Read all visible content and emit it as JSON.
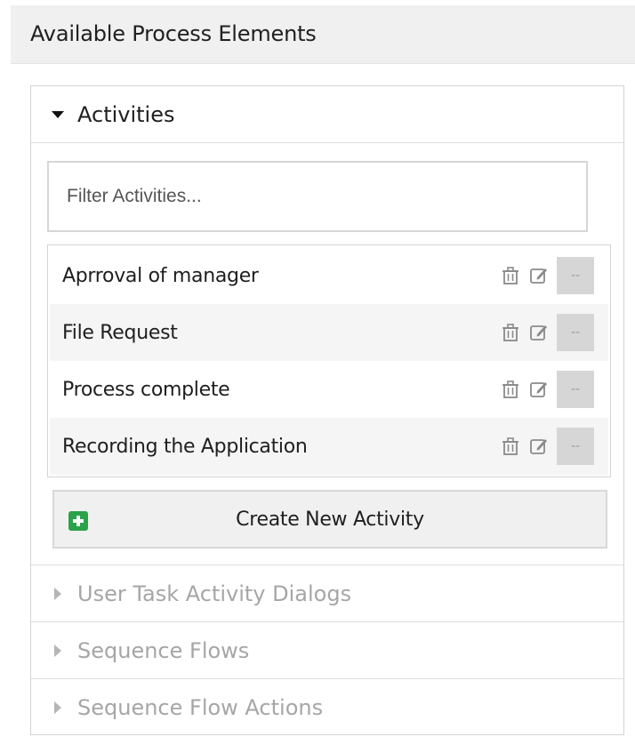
{
  "panel": {
    "title": "Available Process Elements"
  },
  "activities": {
    "header": "Activities",
    "filter_placeholder": "Filter Activities...",
    "items": [
      {
        "name": "Aprroval of manager",
        "actions": [
          "trash-icon",
          "edit-icon",
          "--"
        ]
      },
      {
        "name": "File Request",
        "actions": [
          "trash-icon",
          "edit-icon",
          "--"
        ]
      },
      {
        "name": "Process complete",
        "actions": [
          "trash-icon",
          "edit-icon",
          "--"
        ]
      },
      {
        "name": "Recording the Application",
        "actions": [
          "trash-icon",
          "edit-icon",
          "--"
        ]
      }
    ],
    "create_button": "Create New Activity"
  },
  "sections": [
    {
      "label": "User Task Activity Dialogs"
    },
    {
      "label": "Sequence Flows"
    },
    {
      "label": "Sequence Flow Actions"
    }
  ],
  "colors": {
    "accent_green": "#2aa24a",
    "header_bg": "#f0f0f0",
    "muted_text": "#a6a6a6"
  }
}
